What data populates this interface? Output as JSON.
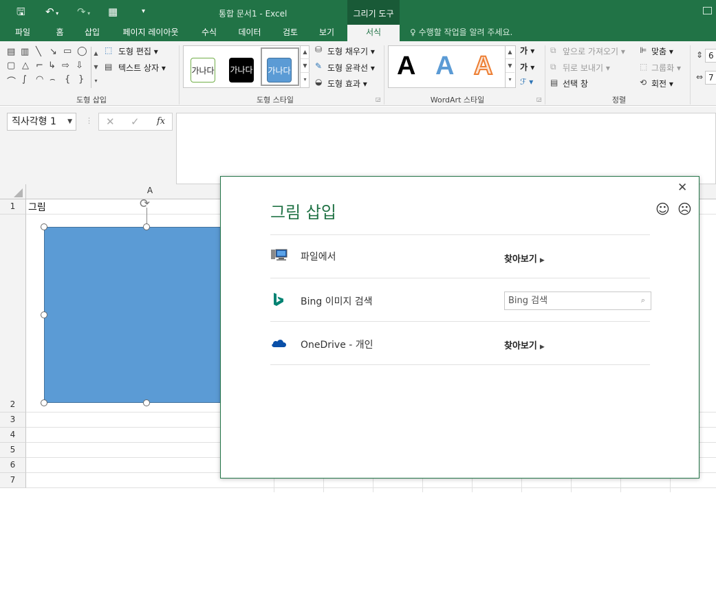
{
  "titlebar": {
    "doc_title": "통합 문서1 - Excel",
    "tools_label": "그리기 도구"
  },
  "tabs": [
    {
      "label": "파일"
    },
    {
      "label": "홈"
    },
    {
      "label": "삽입"
    },
    {
      "label": "페이지 레이아웃"
    },
    {
      "label": "수식"
    },
    {
      "label": "데이터"
    },
    {
      "label": "검토"
    },
    {
      "label": "보기"
    },
    {
      "label": "서식"
    }
  ],
  "tell_me": "수행할 작업을 알려 주세요.",
  "ribbon": {
    "insert_shapes": {
      "edit_shape": "도형 편집",
      "text_box": "텍스트 상자",
      "group_label": "도형 삽입"
    },
    "shape_styles": {
      "style_sample": "가나다",
      "fill": "도형 채우기",
      "outline": "도형 윤곽선",
      "effects": "도형 효과",
      "group_label": "도형 스타일"
    },
    "wordart": {
      "sample": "A",
      "group_label": "WordArt 스타일"
    },
    "arrange": {
      "bring_forward": "앞으로 가져오기",
      "send_backward": "뒤로 보내기",
      "selection_pane": "선택 창",
      "align": "맞춤",
      "group": "그룹화",
      "rotate": "회전",
      "group_label": "정렬"
    },
    "size": {
      "height_partial": "6",
      "width_partial": "7"
    },
    "colors": {
      "red": "#e81123",
      "blue": "#2f5597"
    }
  },
  "formula_bar": {
    "name_box": "직사각형 1",
    "fx": "fx"
  },
  "sheet": {
    "column_a": "A",
    "rows": [
      "1",
      "2",
      "3",
      "4",
      "5",
      "6",
      "7"
    ],
    "a1_value": "그림"
  },
  "dialog": {
    "title": "그림 삽입",
    "options": [
      {
        "label": "파일에서",
        "action": "찾아보기"
      },
      {
        "label": "Bing 이미지 검색",
        "search_placeholder": "Bing 검색"
      },
      {
        "label": "OneDrive - 개인",
        "action": "찾아보기"
      }
    ]
  },
  "colors": {
    "excel_green": "#217346",
    "shape_fill": "#5b9bd5"
  }
}
